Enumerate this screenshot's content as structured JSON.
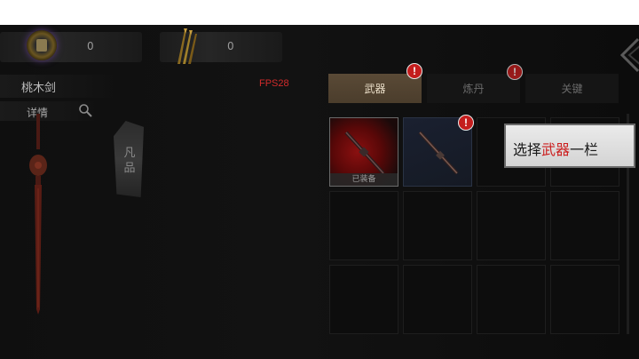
{
  "resources": {
    "currency_1": {
      "icon": "spirit-coin-icon",
      "value": "0"
    },
    "currency_2": {
      "icon": "golden-arrows-icon",
      "value": "0"
    }
  },
  "fps": "FPS28",
  "item": {
    "name": "桃木剑",
    "detail_label": "详情",
    "rank_text": "凡品"
  },
  "tabs": [
    {
      "label": "武器",
      "active": true,
      "badge": "!"
    },
    {
      "label": "炼丹",
      "active": false,
      "badge": "!"
    },
    {
      "label": "关键",
      "active": false
    }
  ],
  "slots": {
    "equipped_label": "已装备",
    "slot_2_badge": "!"
  },
  "tooltip": {
    "prefix": "选择",
    "highlight": "武器",
    "suffix": "一栏"
  },
  "colors": {
    "accent_red": "#c41d1d",
    "tab_active": "#5a4a36",
    "fps_color": "#d12b2b"
  }
}
